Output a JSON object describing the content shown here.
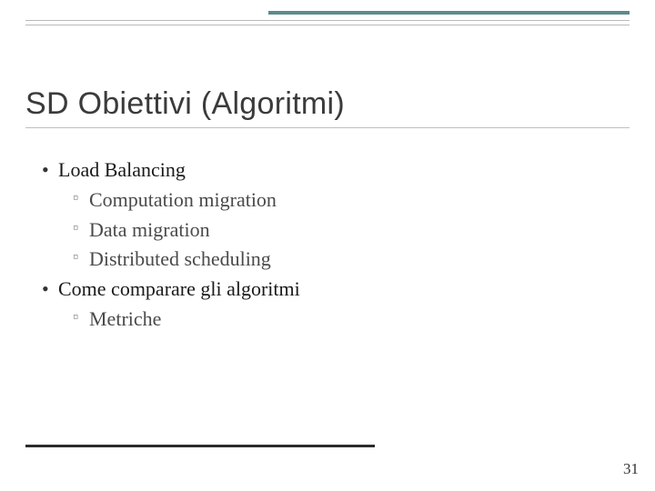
{
  "colors": {
    "accent": "#5c8b8a",
    "rule": "#b9b9b9",
    "titleUnderline": "#bfbfbf",
    "bottomRule": "#2b2b2b"
  },
  "title": "SD Obiettivi (Algoritmi)",
  "bullets": [
    {
      "text": "Load Balancing",
      "sub": [
        "Computation migration",
        "Data migration",
        "Distributed scheduling"
      ]
    },
    {
      "text": "Come comparare gli algoritmi",
      "sub": [
        "Metriche"
      ]
    }
  ],
  "page_number": "31"
}
